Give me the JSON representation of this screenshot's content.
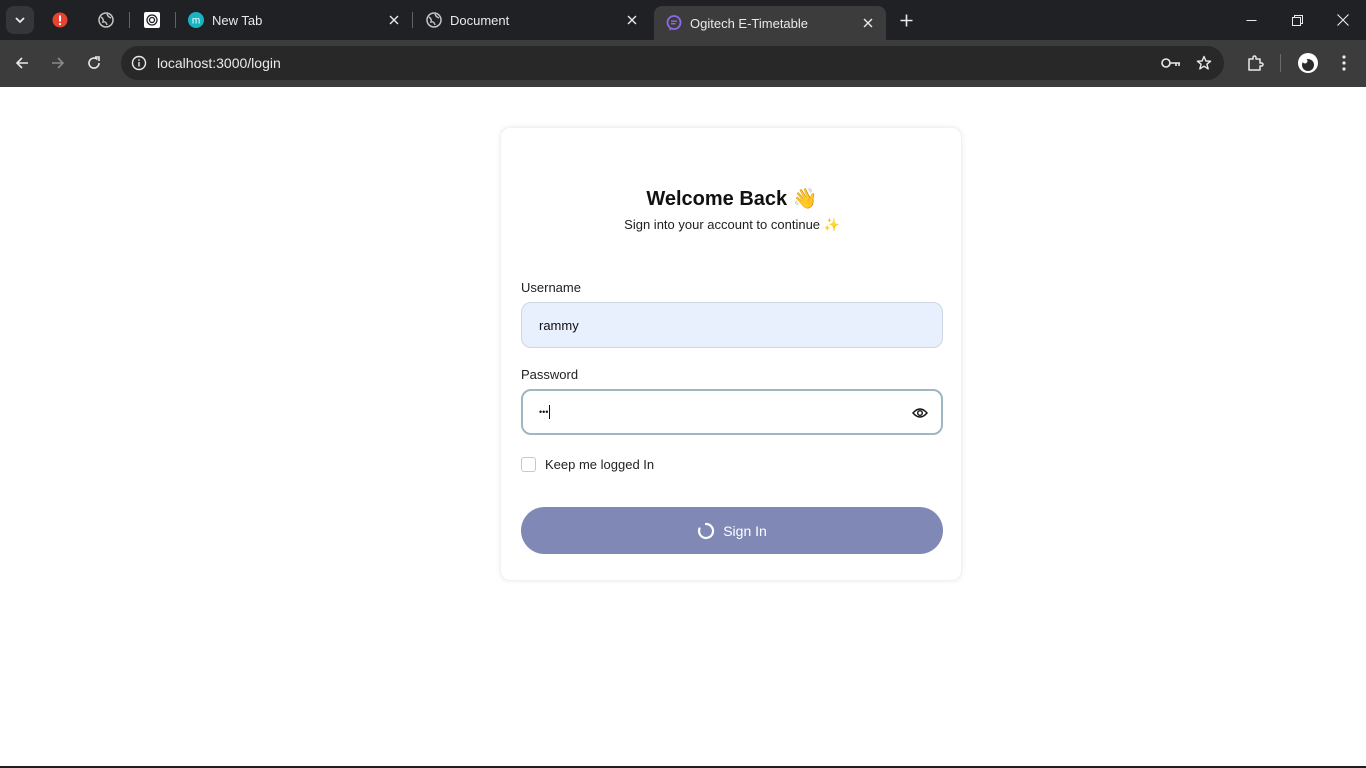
{
  "browser": {
    "tabs": [
      {
        "title": "New Tab"
      },
      {
        "title": "Document"
      },
      {
        "title": "Ogitech E-Timetable",
        "active": true
      }
    ],
    "url": "localhost:3000/login"
  },
  "login": {
    "heading": "Welcome Back 👋",
    "subheading": "Sign into your account to continue ✨",
    "username_label": "Username",
    "username_value": "rammy",
    "password_label": "Password",
    "password_value": "•••",
    "keep_logged_in_label": "Keep me logged In",
    "keep_logged_in_checked": false,
    "signin_label": "Sign In",
    "signin_loading": true
  },
  "colors": {
    "chrome_bg": "#202124",
    "toolbar_bg": "#3c3c3c",
    "button_bg": "#8089b5",
    "input_autofill": "#e8f0fe"
  }
}
